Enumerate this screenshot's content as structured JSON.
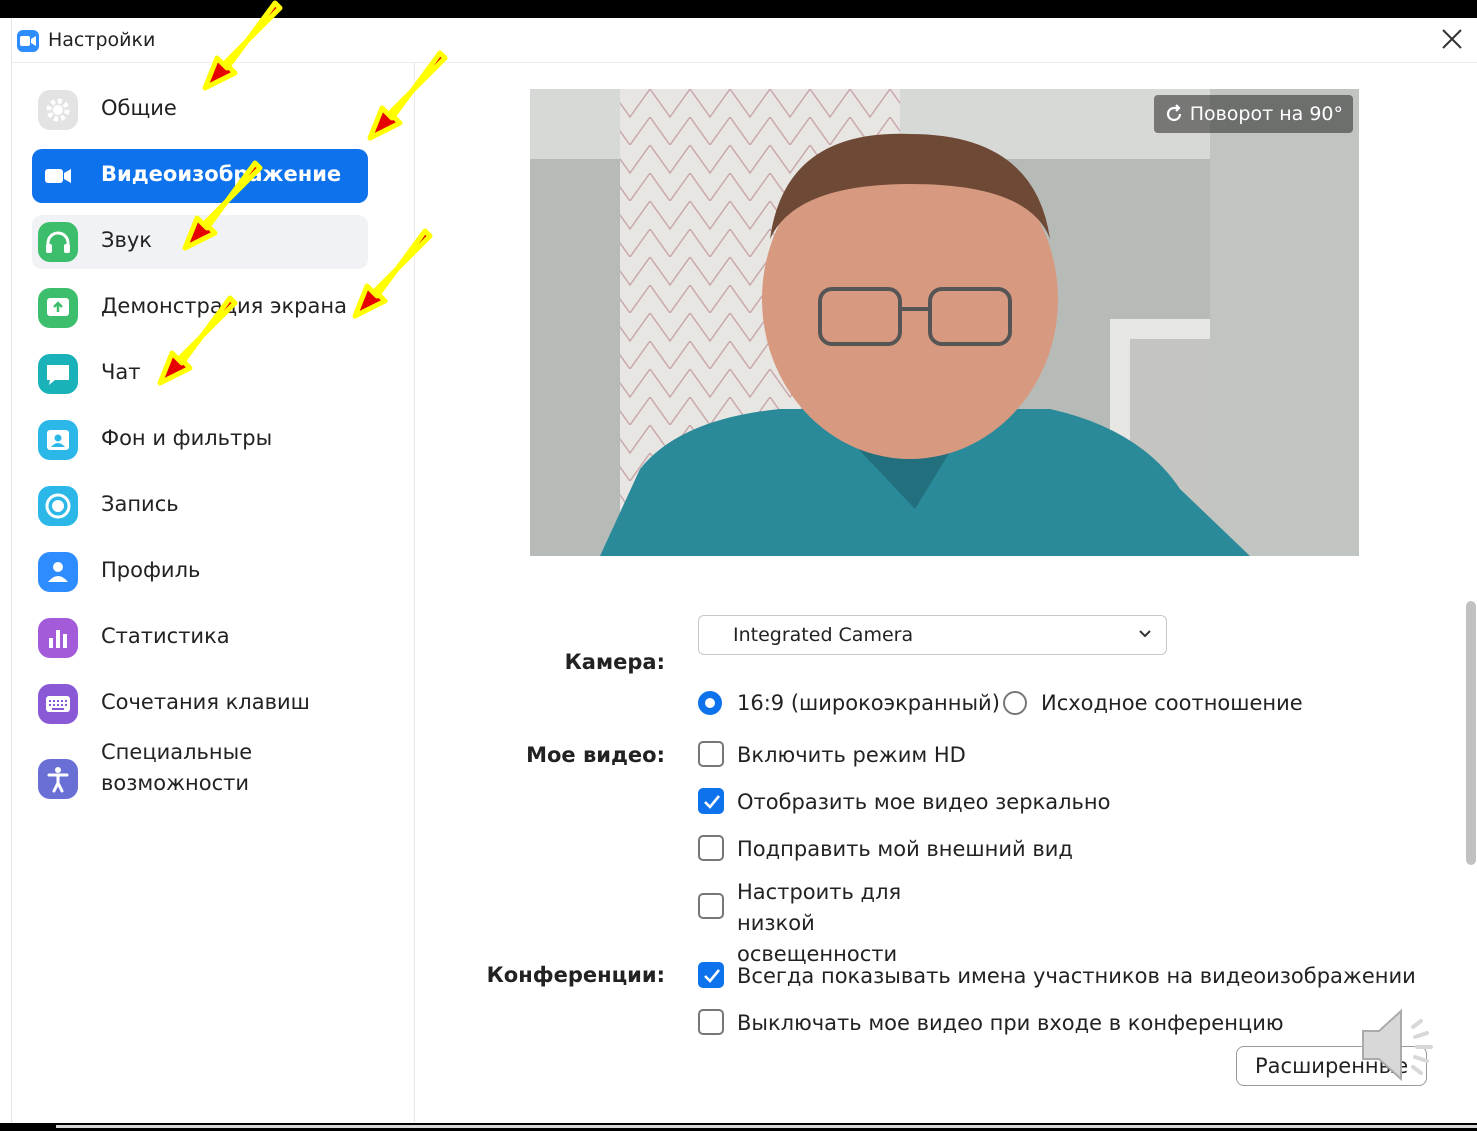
{
  "window": {
    "title": "Настройки"
  },
  "sidebar": {
    "items": [
      {
        "label": "Общие",
        "icon": "gear-icon",
        "active": false
      },
      {
        "label": "Видеоизображение",
        "icon": "video-camera-icon",
        "active": true
      },
      {
        "label": "Звук",
        "icon": "headphones-icon",
        "active": false
      },
      {
        "label": "Демонстрация экрана",
        "icon": "share-screen-icon",
        "active": false
      },
      {
        "label": "Чат",
        "icon": "chat-icon",
        "active": false
      },
      {
        "label": "Фон и фильтры",
        "icon": "background-icon",
        "active": false
      },
      {
        "label": "Запись",
        "icon": "record-icon",
        "active": false
      },
      {
        "label": "Профиль",
        "icon": "profile-icon",
        "active": false
      },
      {
        "label": "Статистика",
        "icon": "statistics-icon",
        "active": false
      },
      {
        "label": "Сочетания клавиш",
        "icon": "keyboard-icon",
        "active": false
      },
      {
        "label": "Специальные возможности",
        "icon": "accessibility-icon",
        "active": false
      }
    ]
  },
  "preview": {
    "rotate_label": "Поворот на 90°"
  },
  "camera": {
    "label": "Камера:",
    "selected": "Integrated Camera"
  },
  "aspect": {
    "wide_label": "16:9 (широкоэкранный)",
    "wide_selected": true,
    "original_label": "Исходное соотношение",
    "original_selected": false
  },
  "my_video": {
    "label": "Мое видео:",
    "options": [
      {
        "label": "Включить режим HD",
        "checked": false
      },
      {
        "label": "Отобразить мое видео зеркально",
        "checked": true
      },
      {
        "label": "Подправить мой внешний вид",
        "checked": false
      },
      {
        "label": "Настроить для низкой освещенности",
        "checked": false
      }
    ]
  },
  "conferences": {
    "label": "Конференции:",
    "options": [
      {
        "label": "Всегда показывать имена участников на видеоизображении",
        "checked": true
      },
      {
        "label": "Выключать мое видео при входе в конференцию",
        "checked": false
      }
    ]
  },
  "advanced_button": "Расширенные",
  "colors": {
    "accent": "#0e72ed",
    "arrow_fill": "#e60000",
    "arrow_outline": "#ffff00"
  }
}
